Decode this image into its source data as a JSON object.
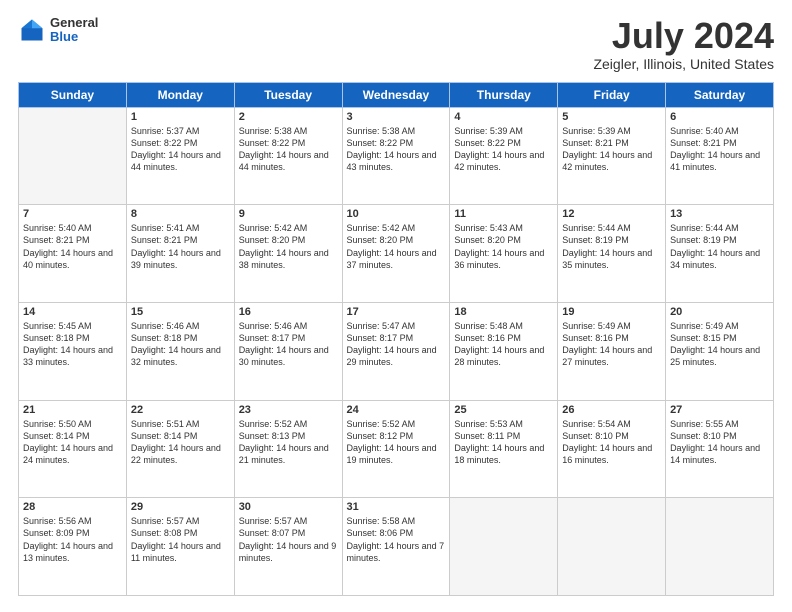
{
  "logo": {
    "general": "General",
    "blue": "Blue"
  },
  "header": {
    "title": "July 2024",
    "subtitle": "Zeigler, Illinois, United States"
  },
  "weekdays": [
    "Sunday",
    "Monday",
    "Tuesday",
    "Wednesday",
    "Thursday",
    "Friday",
    "Saturday"
  ],
  "weeks": [
    [
      {
        "day": "",
        "sunrise": "",
        "sunset": "",
        "daylight": ""
      },
      {
        "day": "1",
        "sunrise": "Sunrise: 5:37 AM",
        "sunset": "Sunset: 8:22 PM",
        "daylight": "Daylight: 14 hours and 44 minutes."
      },
      {
        "day": "2",
        "sunrise": "Sunrise: 5:38 AM",
        "sunset": "Sunset: 8:22 PM",
        "daylight": "Daylight: 14 hours and 44 minutes."
      },
      {
        "day": "3",
        "sunrise": "Sunrise: 5:38 AM",
        "sunset": "Sunset: 8:22 PM",
        "daylight": "Daylight: 14 hours and 43 minutes."
      },
      {
        "day": "4",
        "sunrise": "Sunrise: 5:39 AM",
        "sunset": "Sunset: 8:22 PM",
        "daylight": "Daylight: 14 hours and 42 minutes."
      },
      {
        "day": "5",
        "sunrise": "Sunrise: 5:39 AM",
        "sunset": "Sunset: 8:21 PM",
        "daylight": "Daylight: 14 hours and 42 minutes."
      },
      {
        "day": "6",
        "sunrise": "Sunrise: 5:40 AM",
        "sunset": "Sunset: 8:21 PM",
        "daylight": "Daylight: 14 hours and 41 minutes."
      }
    ],
    [
      {
        "day": "7",
        "sunrise": "Sunrise: 5:40 AM",
        "sunset": "Sunset: 8:21 PM",
        "daylight": "Daylight: 14 hours and 40 minutes."
      },
      {
        "day": "8",
        "sunrise": "Sunrise: 5:41 AM",
        "sunset": "Sunset: 8:21 PM",
        "daylight": "Daylight: 14 hours and 39 minutes."
      },
      {
        "day": "9",
        "sunrise": "Sunrise: 5:42 AM",
        "sunset": "Sunset: 8:20 PM",
        "daylight": "Daylight: 14 hours and 38 minutes."
      },
      {
        "day": "10",
        "sunrise": "Sunrise: 5:42 AM",
        "sunset": "Sunset: 8:20 PM",
        "daylight": "Daylight: 14 hours and 37 minutes."
      },
      {
        "day": "11",
        "sunrise": "Sunrise: 5:43 AM",
        "sunset": "Sunset: 8:20 PM",
        "daylight": "Daylight: 14 hours and 36 minutes."
      },
      {
        "day": "12",
        "sunrise": "Sunrise: 5:44 AM",
        "sunset": "Sunset: 8:19 PM",
        "daylight": "Daylight: 14 hours and 35 minutes."
      },
      {
        "day": "13",
        "sunrise": "Sunrise: 5:44 AM",
        "sunset": "Sunset: 8:19 PM",
        "daylight": "Daylight: 14 hours and 34 minutes."
      }
    ],
    [
      {
        "day": "14",
        "sunrise": "Sunrise: 5:45 AM",
        "sunset": "Sunset: 8:18 PM",
        "daylight": "Daylight: 14 hours and 33 minutes."
      },
      {
        "day": "15",
        "sunrise": "Sunrise: 5:46 AM",
        "sunset": "Sunset: 8:18 PM",
        "daylight": "Daylight: 14 hours and 32 minutes."
      },
      {
        "day": "16",
        "sunrise": "Sunrise: 5:46 AM",
        "sunset": "Sunset: 8:17 PM",
        "daylight": "Daylight: 14 hours and 30 minutes."
      },
      {
        "day": "17",
        "sunrise": "Sunrise: 5:47 AM",
        "sunset": "Sunset: 8:17 PM",
        "daylight": "Daylight: 14 hours and 29 minutes."
      },
      {
        "day": "18",
        "sunrise": "Sunrise: 5:48 AM",
        "sunset": "Sunset: 8:16 PM",
        "daylight": "Daylight: 14 hours and 28 minutes."
      },
      {
        "day": "19",
        "sunrise": "Sunrise: 5:49 AM",
        "sunset": "Sunset: 8:16 PM",
        "daylight": "Daylight: 14 hours and 27 minutes."
      },
      {
        "day": "20",
        "sunrise": "Sunrise: 5:49 AM",
        "sunset": "Sunset: 8:15 PM",
        "daylight": "Daylight: 14 hours and 25 minutes."
      }
    ],
    [
      {
        "day": "21",
        "sunrise": "Sunrise: 5:50 AM",
        "sunset": "Sunset: 8:14 PM",
        "daylight": "Daylight: 14 hours and 24 minutes."
      },
      {
        "day": "22",
        "sunrise": "Sunrise: 5:51 AM",
        "sunset": "Sunset: 8:14 PM",
        "daylight": "Daylight: 14 hours and 22 minutes."
      },
      {
        "day": "23",
        "sunrise": "Sunrise: 5:52 AM",
        "sunset": "Sunset: 8:13 PM",
        "daylight": "Daylight: 14 hours and 21 minutes."
      },
      {
        "day": "24",
        "sunrise": "Sunrise: 5:52 AM",
        "sunset": "Sunset: 8:12 PM",
        "daylight": "Daylight: 14 hours and 19 minutes."
      },
      {
        "day": "25",
        "sunrise": "Sunrise: 5:53 AM",
        "sunset": "Sunset: 8:11 PM",
        "daylight": "Daylight: 14 hours and 18 minutes."
      },
      {
        "day": "26",
        "sunrise": "Sunrise: 5:54 AM",
        "sunset": "Sunset: 8:10 PM",
        "daylight": "Daylight: 14 hours and 16 minutes."
      },
      {
        "day": "27",
        "sunrise": "Sunrise: 5:55 AM",
        "sunset": "Sunset: 8:10 PM",
        "daylight": "Daylight: 14 hours and 14 minutes."
      }
    ],
    [
      {
        "day": "28",
        "sunrise": "Sunrise: 5:56 AM",
        "sunset": "Sunset: 8:09 PM",
        "daylight": "Daylight: 14 hours and 13 minutes."
      },
      {
        "day": "29",
        "sunrise": "Sunrise: 5:57 AM",
        "sunset": "Sunset: 8:08 PM",
        "daylight": "Daylight: 14 hours and 11 minutes."
      },
      {
        "day": "30",
        "sunrise": "Sunrise: 5:57 AM",
        "sunset": "Sunset: 8:07 PM",
        "daylight": "Daylight: 14 hours and 9 minutes."
      },
      {
        "day": "31",
        "sunrise": "Sunrise: 5:58 AM",
        "sunset": "Sunset: 8:06 PM",
        "daylight": "Daylight: 14 hours and 7 minutes."
      },
      {
        "day": "",
        "sunrise": "",
        "sunset": "",
        "daylight": ""
      },
      {
        "day": "",
        "sunrise": "",
        "sunset": "",
        "daylight": ""
      },
      {
        "day": "",
        "sunrise": "",
        "sunset": "",
        "daylight": ""
      }
    ]
  ]
}
